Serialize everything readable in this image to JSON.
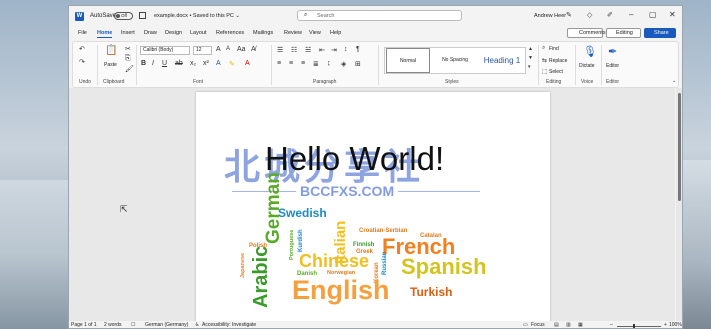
{
  "titlebar": {
    "autosave_label": "AutoSave",
    "autosave_state": "Off",
    "doc_title": "example.docx • Saved to this PC ⌄",
    "search_placeholder": "Search",
    "user_name": "Andrew Heer"
  },
  "menu": [
    "File",
    "Home",
    "Insert",
    "Draw",
    "Design",
    "Layout",
    "References",
    "Mailings",
    "Review",
    "View",
    "Help"
  ],
  "actions": {
    "comments": "Comments",
    "editing": "Editing",
    "share": "Share"
  },
  "ribbon": {
    "paste": "Paste",
    "font_name": "Calibri (Body)",
    "font_size": "12",
    "styles": {
      "normal": "Normal",
      "no_spacing": "No Spacing",
      "heading1": "Heading 1"
    },
    "find": "Find",
    "replace": "Replace",
    "select": "Select",
    "dictate": "Dictate",
    "editor": "Editor",
    "groups": [
      "Undo",
      "Clipboard",
      "Font",
      "Paragraph",
      "Styles",
      "Editing",
      "Voice",
      "Editor"
    ]
  },
  "document": {
    "heading": "Hello World!",
    "watermark_cn": "北城分享社",
    "watermark_en": "BCCFXS.COM",
    "word_cloud": [
      {
        "word": "Swedish",
        "color": "#1a8ac4"
      },
      {
        "word": "German",
        "color": "#5aaa2a"
      },
      {
        "word": "Italian",
        "color": "#f0c020"
      },
      {
        "word": "Croatian-Serbian",
        "color": "#e07b20"
      },
      {
        "word": "Catalan",
        "color": "#e07b20"
      },
      {
        "word": "French",
        "color": "#f08020"
      },
      {
        "word": "Polish",
        "color": "#e07b20"
      },
      {
        "word": "Portuguese",
        "color": "#5aaa2a"
      },
      {
        "word": "Kurdish",
        "color": "#1a8ac4"
      },
      {
        "word": "Finnish",
        "color": "#3a9a2a"
      },
      {
        "word": "Greek",
        "color": "#e07b20"
      },
      {
        "word": "Arabic",
        "color": "#3a9a2a"
      },
      {
        "word": "Chinese",
        "color": "#f0c020"
      },
      {
        "word": "Japanese",
        "color": "#f08020"
      },
      {
        "word": "Danish",
        "color": "#5aaa2a"
      },
      {
        "word": "Norwegian",
        "color": "#e07b20"
      },
      {
        "word": "Korean",
        "color": "#e07b20"
      },
      {
        "word": "Russian",
        "color": "#1a8ac4"
      },
      {
        "word": "Spanish",
        "color": "#d4c420"
      },
      {
        "word": "English",
        "color": "#f5a040"
      },
      {
        "word": "Turkish",
        "color": "#d86010"
      }
    ]
  },
  "status": {
    "page": "Page 1 of 1",
    "words": "2 words",
    "language": "German (Germany)",
    "accessibility": "Accessibility: Investigate",
    "focus": "Focus",
    "zoom": "100%"
  }
}
